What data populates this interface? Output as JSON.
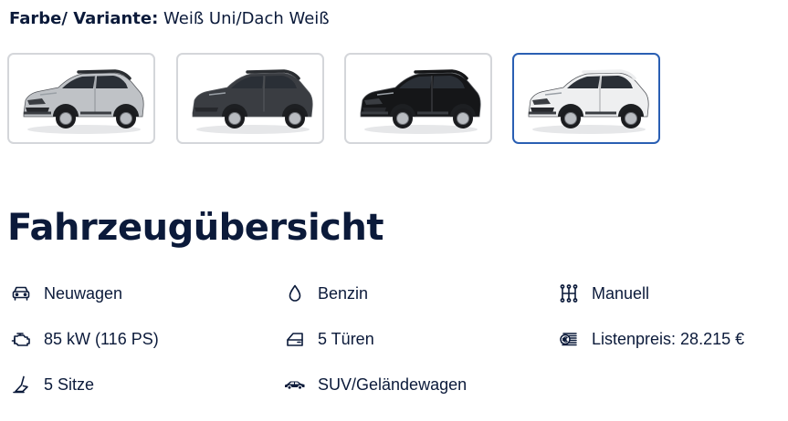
{
  "variant": {
    "label": "Farbe/ Variante:",
    "value": "Weiß Uni/Dach Weiß"
  },
  "swatches": [
    {
      "name": "silver",
      "body": "#bfc2c6",
      "roof": "#2a2d31",
      "selected": false
    },
    {
      "name": "dark-grey",
      "body": "#3a3d42",
      "roof": "#2a2d31",
      "selected": false
    },
    {
      "name": "black",
      "body": "#151618",
      "roof": "#151618",
      "selected": false
    },
    {
      "name": "white",
      "body": "#eeeff0",
      "roof": "#eeeff0",
      "selected": true
    }
  ],
  "title": "Fahrzeugübersicht",
  "specs": {
    "condition": {
      "icon": "car-front-icon",
      "text": "Neuwagen"
    },
    "fuel": {
      "icon": "fuel-drop-icon",
      "text": "Benzin"
    },
    "transmission": {
      "icon": "gearshift-icon",
      "text": "Manuell"
    },
    "power": {
      "icon": "engine-icon",
      "text": "85 kW (116 PS)"
    },
    "doors": {
      "icon": "car-door-icon",
      "text": "5 Türen"
    },
    "price": {
      "icon": "price-money-icon",
      "text": "Listenpreis: 28.215 €"
    },
    "seats": {
      "icon": "car-seat-icon",
      "text": "5 Sitze"
    },
    "body": {
      "icon": "suv-car-icon",
      "text": "SUV/Geländewagen"
    }
  },
  "colors": {
    "text": "#0b1a3a",
    "swatch_border": "#d4d6da",
    "swatch_selected_border": "#2a5fb3"
  }
}
